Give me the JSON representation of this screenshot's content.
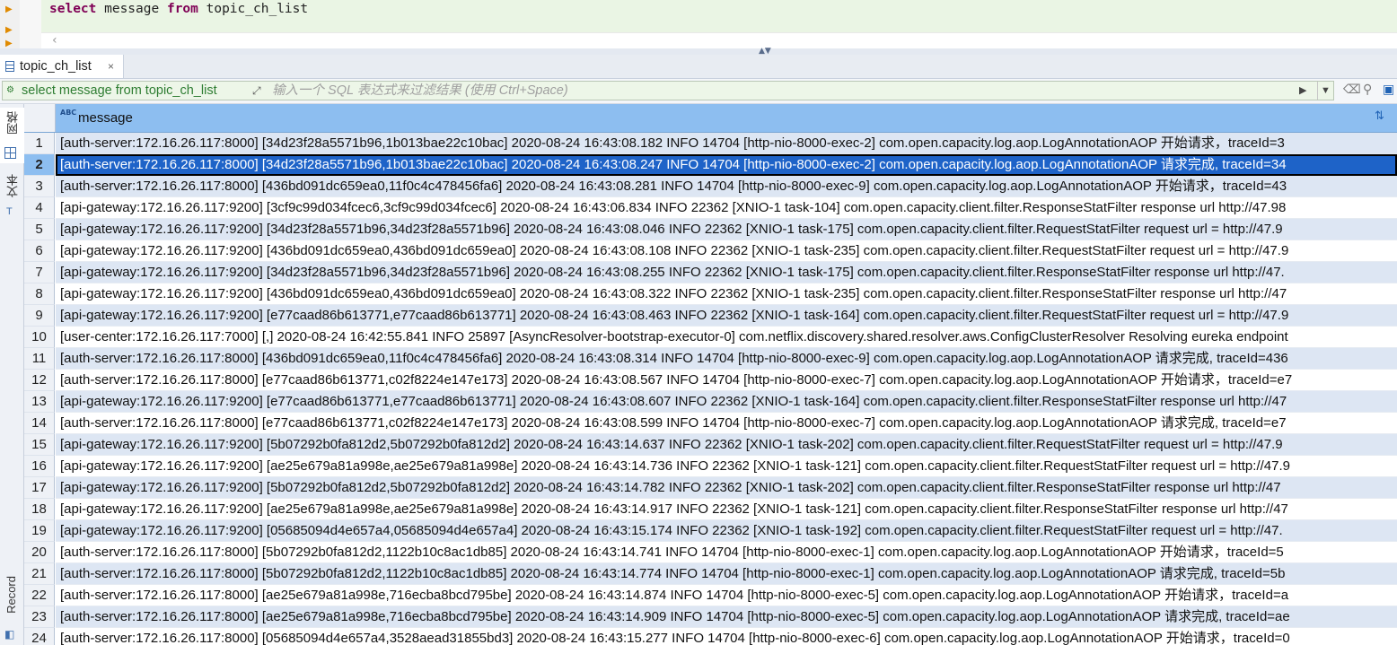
{
  "editor": {
    "sql_keyword_select": "select",
    "sql_column": " message ",
    "sql_keyword_from": "from",
    "sql_table": " topic_ch_list"
  },
  "tab": {
    "label": "topic_ch_list",
    "close": "×"
  },
  "filter": {
    "query": "select message from topic_ch_list",
    "placeholder": "输入一个 SQL 表达式来过滤结果 (使用 Ctrl+Space)"
  },
  "side_tabs": {
    "grid": "网格",
    "text": "文本",
    "record": "Record"
  },
  "grid": {
    "column_type": "ABC",
    "column_name": "message",
    "selected_row": 2,
    "rows": [
      {
        "n": "1",
        "message": "[auth-server:172.16.26.117:8000] [34d23f28a5571b96,1b013bae22c10bac] 2020-08-24 16:43:08.182 INFO 14704 [http-nio-8000-exec-2] com.open.capacity.log.aop.LogAnnotationAOP 开始请求，traceId=3"
      },
      {
        "n": "2",
        "message": "[auth-server:172.16.26.117:8000] [34d23f28a5571b96,1b013bae22c10bac] 2020-08-24 16:43:08.247 INFO 14704 [http-nio-8000-exec-2] com.open.capacity.log.aop.LogAnnotationAOP 请求完成, traceId=34"
      },
      {
        "n": "3",
        "message": "[auth-server:172.16.26.117:8000] [436bd091dc659ea0,11f0c4c478456fa6] 2020-08-24 16:43:08.281 INFO 14704 [http-nio-8000-exec-9] com.open.capacity.log.aop.LogAnnotationAOP 开始请求，traceId=43"
      },
      {
        "n": "4",
        "message": "[api-gateway:172.16.26.117:9200] [3cf9c99d034fcec6,3cf9c99d034fcec6] 2020-08-24 16:43:06.834 INFO 22362 [XNIO-1 task-104] com.open.capacity.client.filter.ResponseStatFilter response url http://47.98"
      },
      {
        "n": "5",
        "message": "[api-gateway:172.16.26.117:9200] [34d23f28a5571b96,34d23f28a5571b96] 2020-08-24 16:43:08.046 INFO 22362 [XNIO-1 task-175] com.open.capacity.client.filter.RequestStatFilter request url = http://47.9"
      },
      {
        "n": "6",
        "message": "[api-gateway:172.16.26.117:9200] [436bd091dc659ea0,436bd091dc659ea0] 2020-08-24 16:43:08.108 INFO 22362 [XNIO-1 task-235] com.open.capacity.client.filter.RequestStatFilter request url = http://47.9"
      },
      {
        "n": "7",
        "message": "[api-gateway:172.16.26.117:9200] [34d23f28a5571b96,34d23f28a5571b96] 2020-08-24 16:43:08.255 INFO 22362 [XNIO-1 task-175] com.open.capacity.client.filter.ResponseStatFilter response url http://47."
      },
      {
        "n": "8",
        "message": "[api-gateway:172.16.26.117:9200] [436bd091dc659ea0,436bd091dc659ea0] 2020-08-24 16:43:08.322 INFO 22362 [XNIO-1 task-235] com.open.capacity.client.filter.ResponseStatFilter response url http://47"
      },
      {
        "n": "9",
        "message": "[api-gateway:172.16.26.117:9200] [e77caad86b613771,e77caad86b613771] 2020-08-24 16:43:08.463 INFO 22362 [XNIO-1 task-164] com.open.capacity.client.filter.RequestStatFilter request url = http://47.9"
      },
      {
        "n": "10",
        "message": "[user-center:172.16.26.117:7000] [,] 2020-08-24 16:42:55.841 INFO 25897 [AsyncResolver-bootstrap-executor-0] com.netflix.discovery.shared.resolver.aws.ConfigClusterResolver Resolving eureka endpoint"
      },
      {
        "n": "11",
        "message": "[auth-server:172.16.26.117:8000] [436bd091dc659ea0,11f0c4c478456fa6] 2020-08-24 16:43:08.314 INFO 14704 [http-nio-8000-exec-9] com.open.capacity.log.aop.LogAnnotationAOP 请求完成, traceId=436"
      },
      {
        "n": "12",
        "message": "[auth-server:172.16.26.117:8000] [e77caad86b613771,c02f8224e147e173] 2020-08-24 16:43:08.567 INFO 14704 [http-nio-8000-exec-7] com.open.capacity.log.aop.LogAnnotationAOP 开始请求，traceId=e7"
      },
      {
        "n": "13",
        "message": "[api-gateway:172.16.26.117:9200] [e77caad86b613771,e77caad86b613771] 2020-08-24 16:43:08.607 INFO 22362 [XNIO-1 task-164] com.open.capacity.client.filter.ResponseStatFilter response url http://47"
      },
      {
        "n": "14",
        "message": "[auth-server:172.16.26.117:8000] [e77caad86b613771,c02f8224e147e173] 2020-08-24 16:43:08.599 INFO 14704 [http-nio-8000-exec-7] com.open.capacity.log.aop.LogAnnotationAOP 请求完成, traceId=e7"
      },
      {
        "n": "15",
        "message": "[api-gateway:172.16.26.117:9200] [5b07292b0fa812d2,5b07292b0fa812d2] 2020-08-24 16:43:14.637 INFO 22362 [XNIO-1 task-202] com.open.capacity.client.filter.RequestStatFilter request url = http://47.9"
      },
      {
        "n": "16",
        "message": "[api-gateway:172.16.26.117:9200] [ae25e679a81a998e,ae25e679a81a998e] 2020-08-24 16:43:14.736 INFO 22362 [XNIO-1 task-121] com.open.capacity.client.filter.RequestStatFilter request url = http://47.9"
      },
      {
        "n": "17",
        "message": "[api-gateway:172.16.26.117:9200] [5b07292b0fa812d2,5b07292b0fa812d2] 2020-08-24 16:43:14.782 INFO 22362 [XNIO-1 task-202] com.open.capacity.client.filter.ResponseStatFilter response url http://47"
      },
      {
        "n": "18",
        "message": "[api-gateway:172.16.26.117:9200] [ae25e679a81a998e,ae25e679a81a998e] 2020-08-24 16:43:14.917 INFO 22362 [XNIO-1 task-121] com.open.capacity.client.filter.ResponseStatFilter response url http://47"
      },
      {
        "n": "19",
        "message": "[api-gateway:172.16.26.117:9200] [05685094d4e657a4,05685094d4e657a4] 2020-08-24 16:43:15.174 INFO 22362 [XNIO-1 task-192] com.open.capacity.client.filter.RequestStatFilter request url = http://47."
      },
      {
        "n": "20",
        "message": "[auth-server:172.16.26.117:8000] [5b07292b0fa812d2,1122b10c8ac1db85] 2020-08-24 16:43:14.741 INFO 14704 [http-nio-8000-exec-1] com.open.capacity.log.aop.LogAnnotationAOP 开始请求，traceId=5"
      },
      {
        "n": "21",
        "message": "[auth-server:172.16.26.117:8000] [5b07292b0fa812d2,1122b10c8ac1db85] 2020-08-24 16:43:14.774 INFO 14704 [http-nio-8000-exec-1] com.open.capacity.log.aop.LogAnnotationAOP 请求完成, traceId=5b"
      },
      {
        "n": "22",
        "message": "[auth-server:172.16.26.117:8000] [ae25e679a81a998e,716ecba8bcd795be] 2020-08-24 16:43:14.874 INFO 14704 [http-nio-8000-exec-5] com.open.capacity.log.aop.LogAnnotationAOP 开始请求，traceId=a"
      },
      {
        "n": "23",
        "message": "[auth-server:172.16.26.117:8000] [ae25e679a81a998e,716ecba8bcd795be] 2020-08-24 16:43:14.909 INFO 14704 [http-nio-8000-exec-5] com.open.capacity.log.aop.LogAnnotationAOP 请求完成, traceId=ae"
      },
      {
        "n": "24",
        "message": "[auth-server:172.16.26.117:8000] [05685094d4e657a4,3528aead31855bd3] 2020-08-24 16:43:15.277 INFO 14704 [http-nio-8000-exec-6] com.open.capacity.log.aop.LogAnnotationAOP 开始请求，traceId=0"
      }
    ]
  }
}
